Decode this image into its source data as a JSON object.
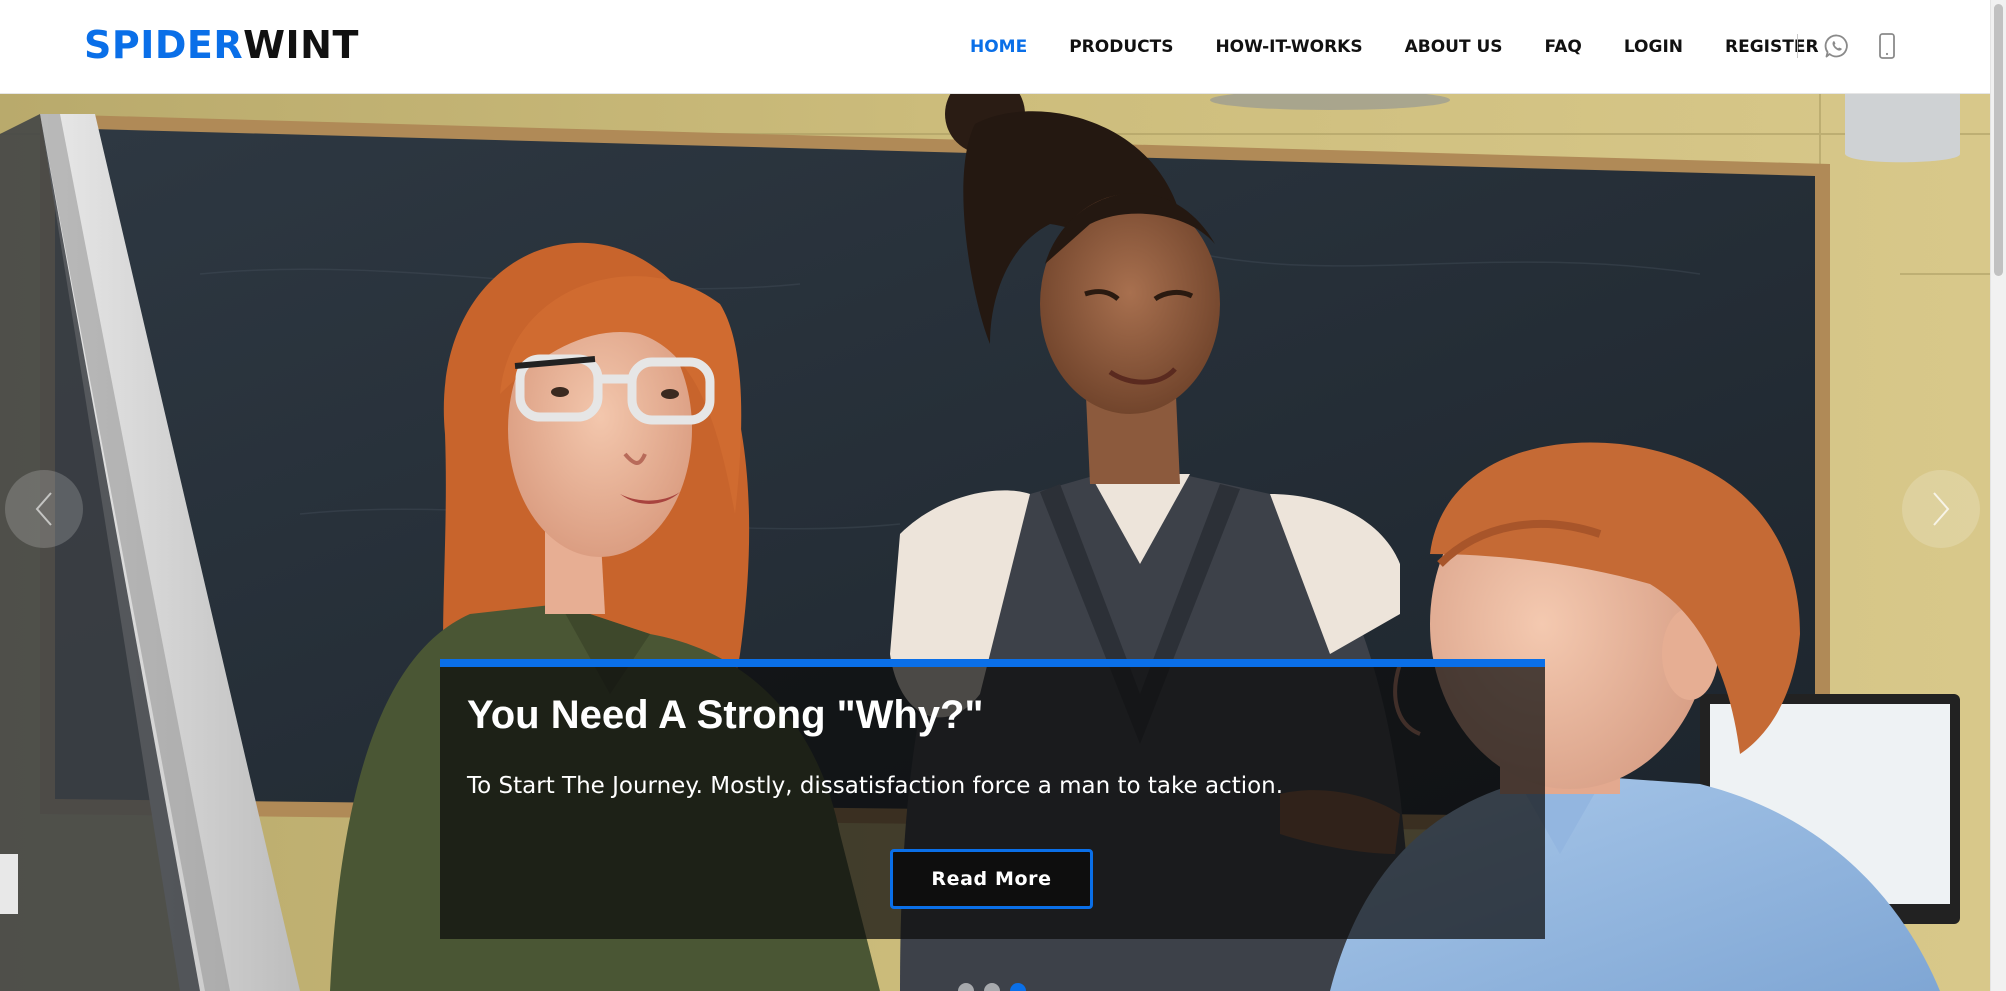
{
  "brand": {
    "part1": "SPIDER",
    "part2": "WINT"
  },
  "nav": {
    "items": [
      {
        "label": "HOME",
        "active": true
      },
      {
        "label": "PRODUCTS",
        "active": false
      },
      {
        "label": "HOW-IT-WORKS",
        "active": false
      },
      {
        "label": "ABOUT US",
        "active": false
      },
      {
        "label": "FAQ",
        "active": false
      },
      {
        "label": "LOGIN",
        "active": false
      },
      {
        "label": "REGISTER",
        "active": false
      }
    ],
    "icons": [
      "whatsapp-icon",
      "mobile-phone-icon"
    ]
  },
  "hero": {
    "slides_count": 3,
    "active_slide": 3,
    "caption": {
      "title": "You Need A Strong \"Why?\"",
      "text": "To Start The Journey. Mostly, dissatisfaction force a man to take action.",
      "button_label": "Read More"
    }
  },
  "colors": {
    "accent": "#0a6fe8",
    "text_dark": "#111111",
    "caption_bg": "rgba(12,12,12,0.72)"
  }
}
